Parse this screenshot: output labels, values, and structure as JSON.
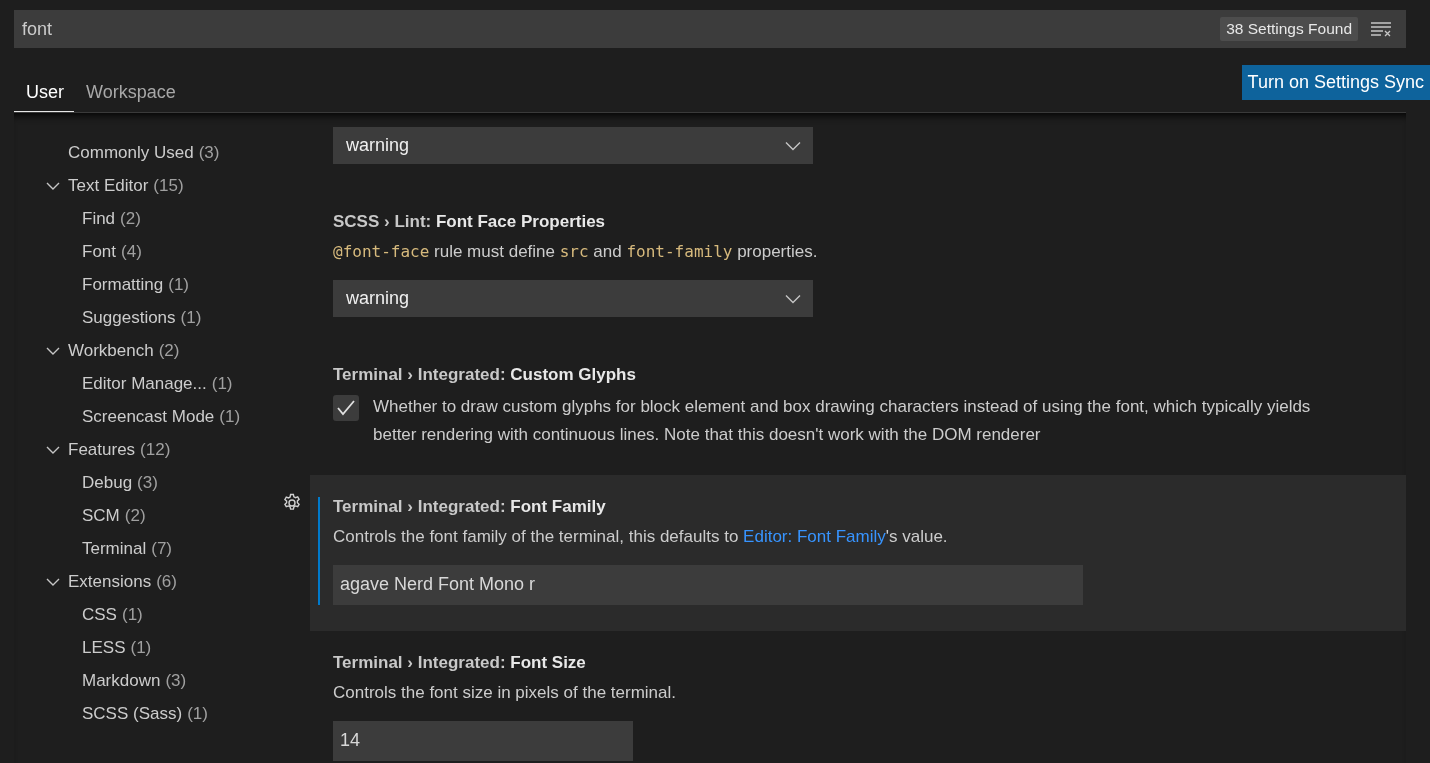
{
  "search": {
    "value": "font",
    "result_count": "38 Settings Found"
  },
  "tabs": [
    {
      "label": "User",
      "selected": true
    },
    {
      "label": "Workspace",
      "selected": false
    }
  ],
  "sync_button": "Turn on Settings Sync",
  "toc": [
    {
      "label": "Commonly Used",
      "count": "(3)"
    },
    {
      "label": "Text Editor",
      "count": "(15)",
      "expanded": true,
      "children": [
        {
          "label": "Find",
          "count": "(2)"
        },
        {
          "label": "Font",
          "count": "(4)"
        },
        {
          "label": "Formatting",
          "count": "(1)"
        },
        {
          "label": "Suggestions",
          "count": "(1)"
        }
      ]
    },
    {
      "label": "Workbench",
      "count": "(2)",
      "expanded": true,
      "children": [
        {
          "label": "Editor Manage...",
          "count": "(1)"
        },
        {
          "label": "Screencast Mode",
          "count": "(1)"
        }
      ]
    },
    {
      "label": "Features",
      "count": "(12)",
      "expanded": true,
      "children": [
        {
          "label": "Debug",
          "count": "(3)"
        },
        {
          "label": "SCM",
          "count": "(2)"
        },
        {
          "label": "Terminal",
          "count": "(7)"
        }
      ]
    },
    {
      "label": "Extensions",
      "count": "(6)",
      "expanded": true,
      "children": [
        {
          "label": "CSS",
          "count": "(1)"
        },
        {
          "label": "LESS",
          "count": "(1)"
        },
        {
          "label": "Markdown",
          "count": "(3)"
        },
        {
          "label": "SCSS (Sass)",
          "count": "(1)"
        }
      ]
    }
  ],
  "settings": [
    {
      "kind": "select",
      "focused": false,
      "value": "warning"
    },
    {
      "kind": "select",
      "focused": false,
      "category": "SCSS › Lint: ",
      "name": "Font Face Properties",
      "description": [
        {
          "kind": "code",
          "text": "@font-face"
        },
        {
          "kind": "text",
          "text": " rule must define "
        },
        {
          "kind": "code",
          "text": "src"
        },
        {
          "kind": "text",
          "text": " and "
        },
        {
          "kind": "code",
          "text": "font-family"
        },
        {
          "kind": "text",
          "text": " properties."
        }
      ],
      "value": "warning"
    },
    {
      "kind": "checkbox",
      "focused": false,
      "category": "Terminal › Integrated: ",
      "name": "Custom Glyphs",
      "checked": true,
      "description": [
        {
          "kind": "text",
          "text": "Whether to draw custom glyphs for block element and box drawing characters instead of using the font, which typically yields better rendering with continuous lines. Note that this doesn't work with the DOM renderer"
        }
      ]
    },
    {
      "kind": "text",
      "focused": true,
      "category": "Terminal › Integrated: ",
      "name": "Font Family",
      "description": [
        {
          "kind": "text",
          "text": "Controls the font family of the terminal, this defaults to "
        },
        {
          "kind": "link",
          "text": "Editor: Font Family"
        },
        {
          "kind": "text",
          "text": "'s value."
        }
      ],
      "value": "agave Nerd Font Mono r"
    },
    {
      "kind": "number",
      "focused": false,
      "category": "Terminal › Integrated: ",
      "name": "Font Size",
      "description": [
        {
          "kind": "text",
          "text": "Controls the font size in pixels of the terminal."
        }
      ],
      "value": "14"
    }
  ]
}
